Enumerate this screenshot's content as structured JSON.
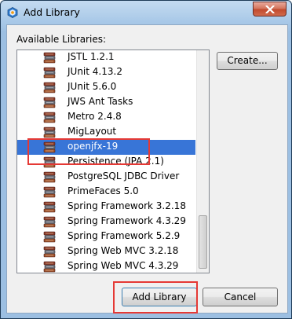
{
  "window": {
    "title": "Add Library",
    "close_icon": "close-icon",
    "app_icon": "netbeans-icon"
  },
  "libraries": {
    "label": "Available Libraries:",
    "items": [
      {
        "label": "JSTL 1.2.1",
        "selected": false
      },
      {
        "label": "JUnit 4.13.2",
        "selected": false
      },
      {
        "label": "JUnit 5.6.0",
        "selected": false
      },
      {
        "label": "JWS Ant Tasks",
        "selected": false
      },
      {
        "label": "Metro 2.4.8",
        "selected": false
      },
      {
        "label": "MigLayout",
        "selected": false
      },
      {
        "label": "openjfx-19",
        "selected": true
      },
      {
        "label": "Persistence (JPA 2.1)",
        "selected": false
      },
      {
        "label": "PostgreSQL JDBC Driver",
        "selected": false
      },
      {
        "label": "PrimeFaces 5.0",
        "selected": false
      },
      {
        "label": "Spring Framework 3.2.18",
        "selected": false
      },
      {
        "label": "Spring Framework 4.3.29",
        "selected": false
      },
      {
        "label": "Spring Framework 5.2.9",
        "selected": false
      },
      {
        "label": "Spring Web MVC 3.2.18",
        "selected": false
      },
      {
        "label": "Spring Web MVC 4.3.29",
        "selected": false
      }
    ],
    "item_icon": "library-books-icon"
  },
  "buttons": {
    "create": "Create...",
    "add_library": "Add Library",
    "cancel": "Cancel"
  },
  "colors": {
    "selection": "#3875d7",
    "highlight_annotation": "#e53935",
    "title_bar": "#a9c9e8"
  }
}
